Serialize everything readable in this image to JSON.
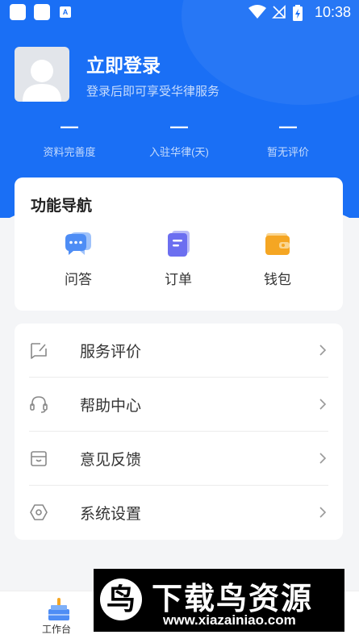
{
  "status_bar": {
    "time": "10:38",
    "notif_letter": "A"
  },
  "profile": {
    "title": "立即登录",
    "subtitle": "登录后即可享受华律服务"
  },
  "stats": [
    {
      "value": "—",
      "label": "资料完善度"
    },
    {
      "value": "—",
      "label": "入驻华律(天)"
    },
    {
      "value": "—",
      "label": "暂无评价"
    }
  ],
  "nav": {
    "title": "功能导航",
    "items": [
      {
        "label": "问答",
        "icon": "chat-bubble-icon"
      },
      {
        "label": "订单",
        "icon": "order-document-icon"
      },
      {
        "label": "钱包",
        "icon": "wallet-icon"
      }
    ]
  },
  "menu": [
    {
      "label": "服务评价",
      "icon": "review-icon"
    },
    {
      "label": "帮助中心",
      "icon": "headset-icon"
    },
    {
      "label": "意见反馈",
      "icon": "feedback-box-icon"
    },
    {
      "label": "系统设置",
      "icon": "hexagon-settings-icon"
    }
  ],
  "tabbar": {
    "items": [
      {
        "label": "工作台",
        "icon": "workbench-icon"
      }
    ]
  },
  "watermark": {
    "title": "下载鸟资源",
    "url": "www.xiazainiao.com",
    "logo_char": "鸟"
  },
  "colors": {
    "brand_blue": "#1a6ff5",
    "background": "#f4f5f7",
    "nav_icon_blue": "#4e8df5",
    "nav_icon_purple": "#6c6ff0",
    "nav_icon_orange": "#f5a623"
  }
}
